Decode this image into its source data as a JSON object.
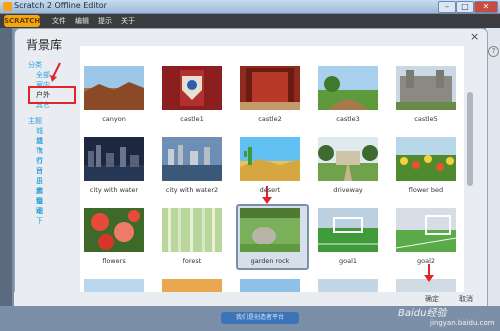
{
  "window": {
    "title": "Scratch 2 Offline Editor",
    "controls": [
      "–",
      "□",
      "✕"
    ]
  },
  "menubar": {
    "logo": "SCRATCH",
    "items": [
      "文件",
      "编辑",
      "提示",
      "关于"
    ]
  },
  "dialog": {
    "title": "背景库",
    "close": "×",
    "ok_label": "确定",
    "cancel_label": "取消"
  },
  "sidebar": {
    "category_header": "分类",
    "categories": [
      "全部",
      "室内",
      "户外",
      "其它"
    ],
    "selected_category": "户外",
    "theme_header": "主题",
    "themes": [
      "城堡",
      "城市",
      "飞行",
      "节日",
      "音乐和舞蹈",
      "自然",
      "太空",
      "运动",
      "水下"
    ]
  },
  "backdrops": [
    {
      "name": "canyon",
      "kind": "canyon"
    },
    {
      "name": "castle1",
      "kind": "castle1"
    },
    {
      "name": "castle2",
      "kind": "castle2"
    },
    {
      "name": "castle3",
      "kind": "castle3"
    },
    {
      "name": "castle5",
      "kind": "castle5"
    },
    {
      "name": "city with water",
      "kind": "citywater"
    },
    {
      "name": "city with water2",
      "kind": "citywater2"
    },
    {
      "name": "desert",
      "kind": "desert"
    },
    {
      "name": "driveway",
      "kind": "driveway"
    },
    {
      "name": "flower bed",
      "kind": "flowerbed"
    },
    {
      "name": "flowers",
      "kind": "flowers"
    },
    {
      "name": "forest",
      "kind": "forest"
    },
    {
      "name": "garden rock",
      "kind": "gardenrock",
      "selected": true
    },
    {
      "name": "goal1",
      "kind": "goal1"
    },
    {
      "name": "goal2",
      "kind": "goal2"
    }
  ],
  "footer": {
    "button_label": "我们是创造者平台"
  },
  "watermark": {
    "brand": "Baidu经验",
    "url": "jingyan.baidu.com"
  },
  "colors": {
    "accent_link": "#2aa0d8",
    "highlight_red": "#e0252c",
    "logo_orange": "#f2a60f"
  }
}
